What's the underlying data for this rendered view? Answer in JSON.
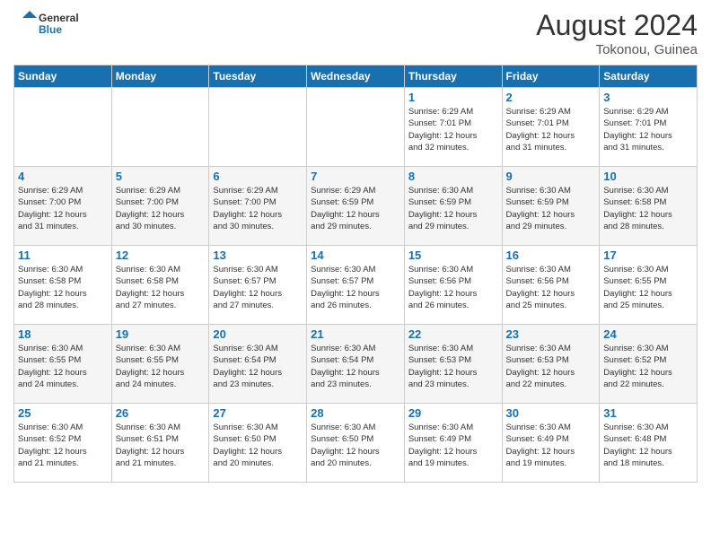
{
  "header": {
    "logo_general": "General",
    "logo_blue": "Blue",
    "month_year": "August 2024",
    "location": "Tokonou, Guinea"
  },
  "weekdays": [
    "Sunday",
    "Monday",
    "Tuesday",
    "Wednesday",
    "Thursday",
    "Friday",
    "Saturday"
  ],
  "weeks": [
    [
      {
        "day": "",
        "info": ""
      },
      {
        "day": "",
        "info": ""
      },
      {
        "day": "",
        "info": ""
      },
      {
        "day": "",
        "info": ""
      },
      {
        "day": "1",
        "info": "Sunrise: 6:29 AM\nSunset: 7:01 PM\nDaylight: 12 hours\nand 32 minutes."
      },
      {
        "day": "2",
        "info": "Sunrise: 6:29 AM\nSunset: 7:01 PM\nDaylight: 12 hours\nand 31 minutes."
      },
      {
        "day": "3",
        "info": "Sunrise: 6:29 AM\nSunset: 7:01 PM\nDaylight: 12 hours\nand 31 minutes."
      }
    ],
    [
      {
        "day": "4",
        "info": "Sunrise: 6:29 AM\nSunset: 7:00 PM\nDaylight: 12 hours\nand 31 minutes."
      },
      {
        "day": "5",
        "info": "Sunrise: 6:29 AM\nSunset: 7:00 PM\nDaylight: 12 hours\nand 30 minutes."
      },
      {
        "day": "6",
        "info": "Sunrise: 6:29 AM\nSunset: 7:00 PM\nDaylight: 12 hours\nand 30 minutes."
      },
      {
        "day": "7",
        "info": "Sunrise: 6:29 AM\nSunset: 6:59 PM\nDaylight: 12 hours\nand 29 minutes."
      },
      {
        "day": "8",
        "info": "Sunrise: 6:30 AM\nSunset: 6:59 PM\nDaylight: 12 hours\nand 29 minutes."
      },
      {
        "day": "9",
        "info": "Sunrise: 6:30 AM\nSunset: 6:59 PM\nDaylight: 12 hours\nand 29 minutes."
      },
      {
        "day": "10",
        "info": "Sunrise: 6:30 AM\nSunset: 6:58 PM\nDaylight: 12 hours\nand 28 minutes."
      }
    ],
    [
      {
        "day": "11",
        "info": "Sunrise: 6:30 AM\nSunset: 6:58 PM\nDaylight: 12 hours\nand 28 minutes."
      },
      {
        "day": "12",
        "info": "Sunrise: 6:30 AM\nSunset: 6:58 PM\nDaylight: 12 hours\nand 27 minutes."
      },
      {
        "day": "13",
        "info": "Sunrise: 6:30 AM\nSunset: 6:57 PM\nDaylight: 12 hours\nand 27 minutes."
      },
      {
        "day": "14",
        "info": "Sunrise: 6:30 AM\nSunset: 6:57 PM\nDaylight: 12 hours\nand 26 minutes."
      },
      {
        "day": "15",
        "info": "Sunrise: 6:30 AM\nSunset: 6:56 PM\nDaylight: 12 hours\nand 26 minutes."
      },
      {
        "day": "16",
        "info": "Sunrise: 6:30 AM\nSunset: 6:56 PM\nDaylight: 12 hours\nand 25 minutes."
      },
      {
        "day": "17",
        "info": "Sunrise: 6:30 AM\nSunset: 6:55 PM\nDaylight: 12 hours\nand 25 minutes."
      }
    ],
    [
      {
        "day": "18",
        "info": "Sunrise: 6:30 AM\nSunset: 6:55 PM\nDaylight: 12 hours\nand 24 minutes."
      },
      {
        "day": "19",
        "info": "Sunrise: 6:30 AM\nSunset: 6:55 PM\nDaylight: 12 hours\nand 24 minutes."
      },
      {
        "day": "20",
        "info": "Sunrise: 6:30 AM\nSunset: 6:54 PM\nDaylight: 12 hours\nand 23 minutes."
      },
      {
        "day": "21",
        "info": "Sunrise: 6:30 AM\nSunset: 6:54 PM\nDaylight: 12 hours\nand 23 minutes."
      },
      {
        "day": "22",
        "info": "Sunrise: 6:30 AM\nSunset: 6:53 PM\nDaylight: 12 hours\nand 23 minutes."
      },
      {
        "day": "23",
        "info": "Sunrise: 6:30 AM\nSunset: 6:53 PM\nDaylight: 12 hours\nand 22 minutes."
      },
      {
        "day": "24",
        "info": "Sunrise: 6:30 AM\nSunset: 6:52 PM\nDaylight: 12 hours\nand 22 minutes."
      }
    ],
    [
      {
        "day": "25",
        "info": "Sunrise: 6:30 AM\nSunset: 6:52 PM\nDaylight: 12 hours\nand 21 minutes."
      },
      {
        "day": "26",
        "info": "Sunrise: 6:30 AM\nSunset: 6:51 PM\nDaylight: 12 hours\nand 21 minutes."
      },
      {
        "day": "27",
        "info": "Sunrise: 6:30 AM\nSunset: 6:50 PM\nDaylight: 12 hours\nand 20 minutes."
      },
      {
        "day": "28",
        "info": "Sunrise: 6:30 AM\nSunset: 6:50 PM\nDaylight: 12 hours\nand 20 minutes."
      },
      {
        "day": "29",
        "info": "Sunrise: 6:30 AM\nSunset: 6:49 PM\nDaylight: 12 hours\nand 19 minutes."
      },
      {
        "day": "30",
        "info": "Sunrise: 6:30 AM\nSunset: 6:49 PM\nDaylight: 12 hours\nand 19 minutes."
      },
      {
        "day": "31",
        "info": "Sunrise: 6:30 AM\nSunset: 6:48 PM\nDaylight: 12 hours\nand 18 minutes."
      }
    ]
  ]
}
